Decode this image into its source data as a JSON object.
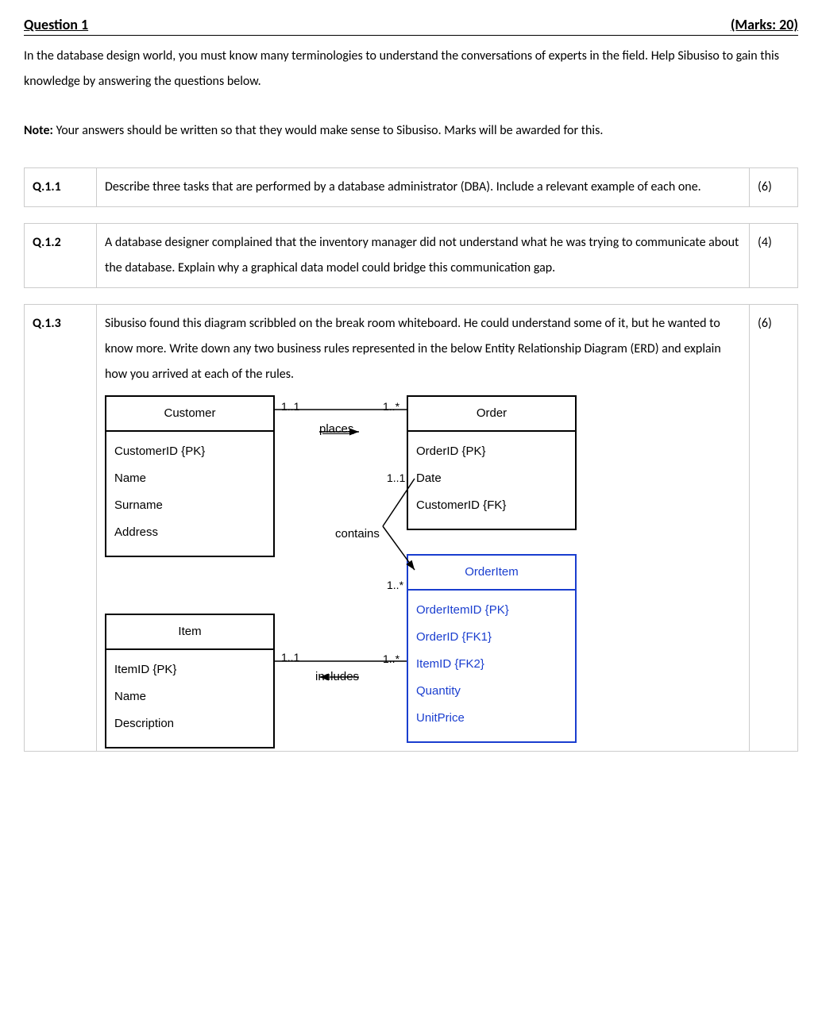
{
  "header": {
    "title": "Question 1",
    "marks": "(Marks: 20)"
  },
  "intro": "In the database design world, you must know many terminologies to understand the conversations of experts in the field. Help Sibusiso to gain this knowledge by answering the questions below.",
  "note_label": "Note:",
  "note_text": " Your answers should be written so that they would make sense to Sibusiso. Marks will be awarded for this.",
  "questions": [
    {
      "num": "Q.1.1",
      "text": "Describe three tasks that are performed by a database administrator (DBA). Include a relevant example of each one.",
      "marks": "(6)"
    },
    {
      "num": "Q.1.2",
      "text": "A database designer complained that the inventory manager did not understand what he was trying to communicate about the database. Explain why a graphical data model could bridge this communication gap.",
      "marks": "(4)"
    },
    {
      "num": "Q.1.3",
      "text": "Sibusiso found this diagram scribbled on the break room whiteboard. He could understand some of it, but he wanted to know more. Write down any two business rules represented in the below Entity Relationship Diagram (ERD) and explain how you arrived at each of the rules.",
      "marks": "(6)"
    }
  ],
  "erd": {
    "customer": {
      "title": "Customer",
      "attrs": [
        "CustomerID {PK}",
        "Name",
        "Surname",
        "Address"
      ]
    },
    "order": {
      "title": "Order",
      "attrs": [
        "OrderID {PK}",
        "Date",
        "CustomerID {FK}"
      ]
    },
    "item": {
      "title": "Item",
      "attrs": [
        "ItemID {PK}",
        "Name",
        "Description"
      ]
    },
    "orderitem": {
      "title": "OrderItem",
      "attrs": [
        "OrderItemID {PK}",
        "OrderID {FK1}",
        "ItemID {FK2}",
        "Quantity",
        "UnitPrice"
      ]
    },
    "rels": {
      "places": {
        "label": "places",
        "left": "1..1",
        "right": "1..*"
      },
      "contains": {
        "label": "contains",
        "top": "1..1",
        "bottom": "1..*"
      },
      "includes": {
        "label": "includes",
        "left": "1..1",
        "right": "1..*"
      }
    }
  }
}
